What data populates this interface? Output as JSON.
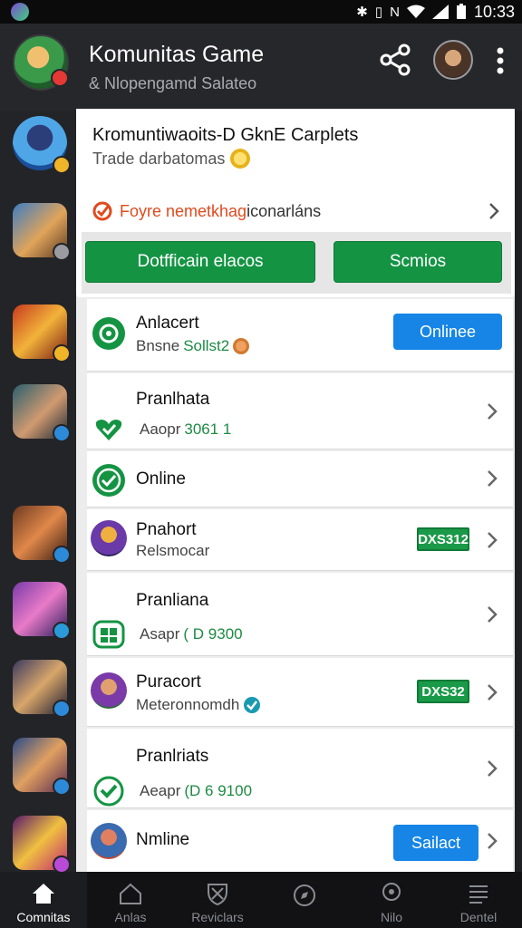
{
  "status_bar": {
    "time": "10:33",
    "icons": [
      "bluetooth-icon",
      "vibrate-icon",
      "nfc-icon",
      "wifi-icon",
      "signal-icon",
      "battery-icon"
    ]
  },
  "header": {
    "title": "Komunitas Game",
    "subtitle": "& Nlopengamd Salateo"
  },
  "top_card": {
    "title": "Kromuntiwaoits-D GknE Carplets",
    "subtitle": "Trade darbatomas",
    "alert_part1": "Foyre nemetkhag",
    "alert_part2": "iconarláns",
    "button_left": "Dotfficain elacos",
    "button_right": "Scmios"
  },
  "rows": [
    {
      "title": "Anlacert",
      "sub_prefix": "Bnsne",
      "sub_value": "Sollst2",
      "action": "Onlinee"
    },
    {
      "title": "Pranlhata",
      "sub_prefix": "Aaopr",
      "sub_value": "3061 1"
    },
    {
      "title": "Online"
    },
    {
      "title": "Pnahort",
      "sub_prefix": "Relsmocar",
      "tag": "DXS312"
    },
    {
      "title": "Pranliana",
      "sub_prefix": "Asapr",
      "sub_value": "( D 9300"
    },
    {
      "title": "Puracort",
      "sub_prefix": "Meteronnomdh",
      "tag": "DXS32"
    },
    {
      "title": "Pranlriats",
      "sub_prefix": "Aeapr",
      "sub_value": "(D 6 9100"
    },
    {
      "title": "Nmline",
      "action": "Sailact"
    }
  ],
  "bottom_nav": [
    {
      "label": "Comnitas",
      "icon": "home-icon"
    },
    {
      "label": "Anlas",
      "icon": "house-outline-icon"
    },
    {
      "label": "Reviclars",
      "icon": "shield-icon"
    },
    {
      "label": "",
      "icon": "compass-icon"
    },
    {
      "label": "Nilo",
      "icon": "location-icon"
    },
    {
      "label": "Dentel",
      "icon": "menu-icon"
    }
  ],
  "colors": {
    "accent_green": "#149443",
    "accent_blue": "#1685e6",
    "alert": "#e04a1e",
    "background": "#1f2023"
  }
}
